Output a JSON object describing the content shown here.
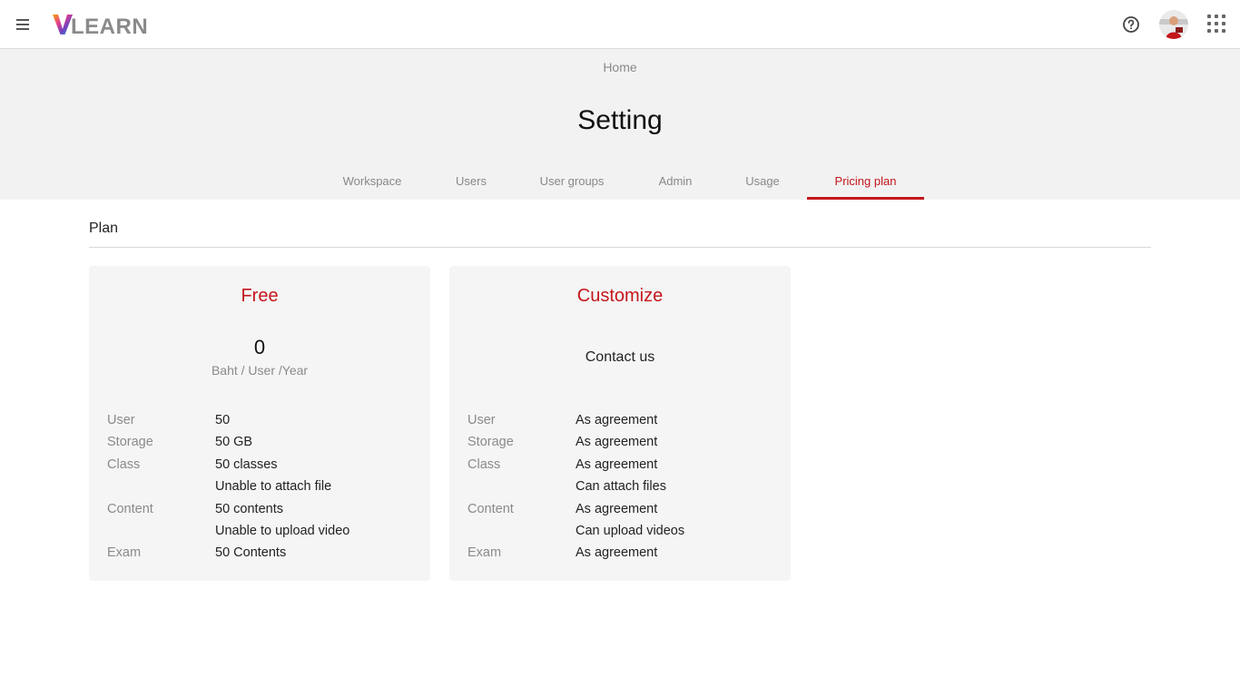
{
  "app": {
    "logo_text": "VLEARN"
  },
  "header": {
    "breadcrumb": "Home",
    "title": "Setting",
    "tabs": [
      {
        "label": "Workspace"
      },
      {
        "label": "Users"
      },
      {
        "label": "User groups"
      },
      {
        "label": "Admin"
      },
      {
        "label": "Usage"
      },
      {
        "label": "Pricing plan",
        "active": true
      }
    ]
  },
  "plan_section": {
    "title": "Plan",
    "plans": [
      {
        "name": "Free",
        "price": "0",
        "price_unit": "Baht / User /Year",
        "rows": [
          {
            "key": "User",
            "value": "50"
          },
          {
            "key": "Storage",
            "value": "50 GB"
          },
          {
            "key": "Class",
            "value": "50 classes"
          },
          {
            "key": "",
            "value": "Unable to attach file"
          },
          {
            "key": "Content",
            "value": "50 contents"
          },
          {
            "key": "",
            "value": "Unable to upload video"
          },
          {
            "key": "Exam",
            "value": "50 Contents"
          }
        ]
      },
      {
        "name": "Customize",
        "contact": "Contact us",
        "rows": [
          {
            "key": "User",
            "value": "As agreement"
          },
          {
            "key": "Storage",
            "value": "As agreement"
          },
          {
            "key": "Class",
            "value": "As agreement"
          },
          {
            "key": "",
            "value": "Can attach files"
          },
          {
            "key": "Content",
            "value": "As agreement"
          },
          {
            "key": "",
            "value": "Can upload videos"
          },
          {
            "key": "Exam",
            "value": "As agreement"
          }
        ]
      }
    ]
  },
  "icons": {
    "menu": "hamburger-menu-icon",
    "help": "help-circle-icon",
    "apps": "apps-grid-icon"
  },
  "colors": {
    "accent": "#c4161c",
    "header_bg": "#f2f2f2",
    "card_bg": "#f5f5f5"
  }
}
